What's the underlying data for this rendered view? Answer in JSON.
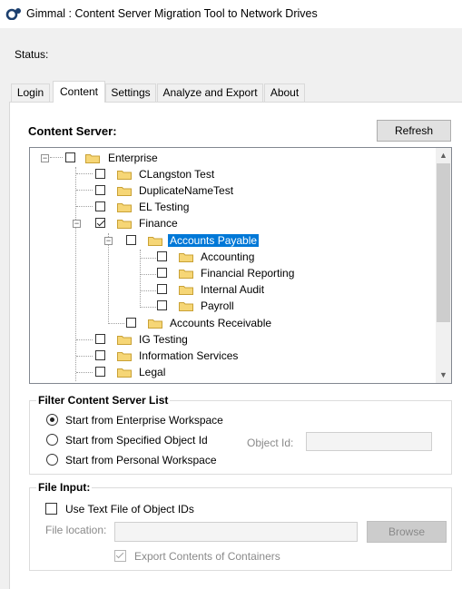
{
  "window": {
    "title": "Gimmal : Content Server Migration Tool to Network Drives"
  },
  "status": {
    "label": "Status:"
  },
  "tabs": [
    {
      "label": "Login"
    },
    {
      "label": "Content"
    },
    {
      "label": "Settings"
    },
    {
      "label": "Analyze and Export"
    },
    {
      "label": "About"
    }
  ],
  "content_server": {
    "label": "Content Server:",
    "refresh_label": "Refresh"
  },
  "tree": {
    "root": "Enterprise",
    "items": [
      "CLangston Test",
      "DuplicateNameTest",
      "EL Testing",
      "Finance",
      "Accounts Payable",
      "Accounting",
      "Financial Reporting",
      "Internal Audit",
      "Payroll",
      "Accounts Receivable",
      "IG Testing",
      "Information Services",
      "Legal"
    ]
  },
  "filter": {
    "title": "Filter Content Server List",
    "options": [
      "Start from Enterprise Workspace",
      "Start from Specified Object Id",
      "Start from Personal Workspace"
    ],
    "object_id_label": "Object Id:",
    "object_id_value": ""
  },
  "file_input": {
    "title": "File Input:",
    "use_text_file_label": "Use Text File of Object IDs",
    "file_location_label": "File location:",
    "file_location_value": "",
    "browse_label": "Browse",
    "export_contents_label": "Export Contents of Containers"
  }
}
